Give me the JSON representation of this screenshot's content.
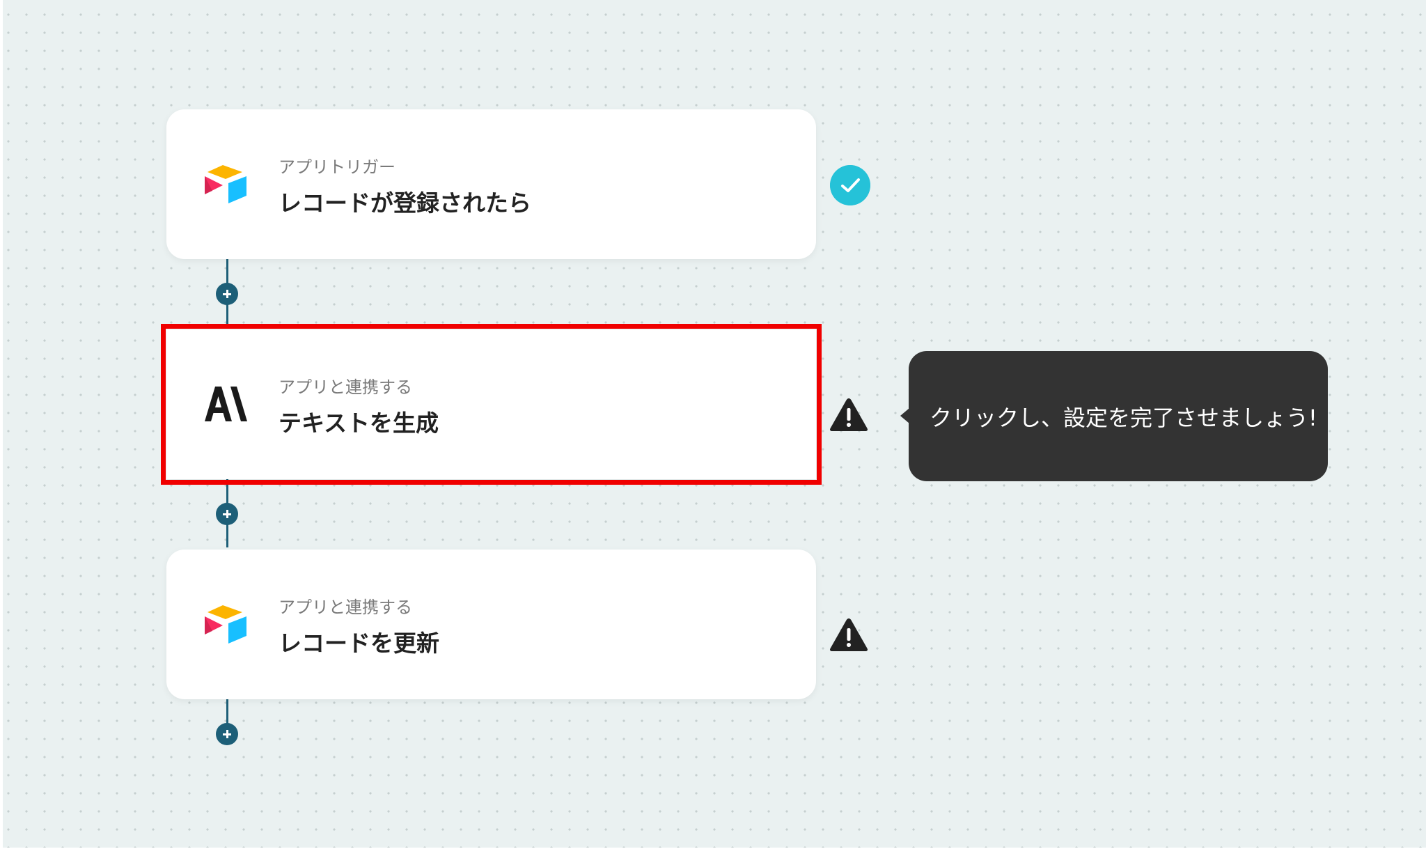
{
  "flow": {
    "steps": [
      {
        "subtitle": "アプリトリガー",
        "title": "レコードが登録されたら",
        "app_icon": "airtable-logo",
        "status": "complete"
      },
      {
        "subtitle": "アプリと連携する",
        "title": "テキストを生成",
        "app_icon": "anthropic-logo",
        "status": "warning",
        "highlighted": true
      },
      {
        "subtitle": "アプリと連携する",
        "title": "レコードを更新",
        "app_icon": "airtable-logo",
        "status": "warning"
      }
    ],
    "add_step_icon": "plus-icon"
  },
  "tooltip": {
    "text": "クリックし、設定を完了させましょう!"
  },
  "colors": {
    "canvas": "#eaf1f1",
    "connector": "#1d5f78",
    "check": "#25c2d8",
    "highlight": "#f00000",
    "tooltip_bg": "#333333"
  }
}
